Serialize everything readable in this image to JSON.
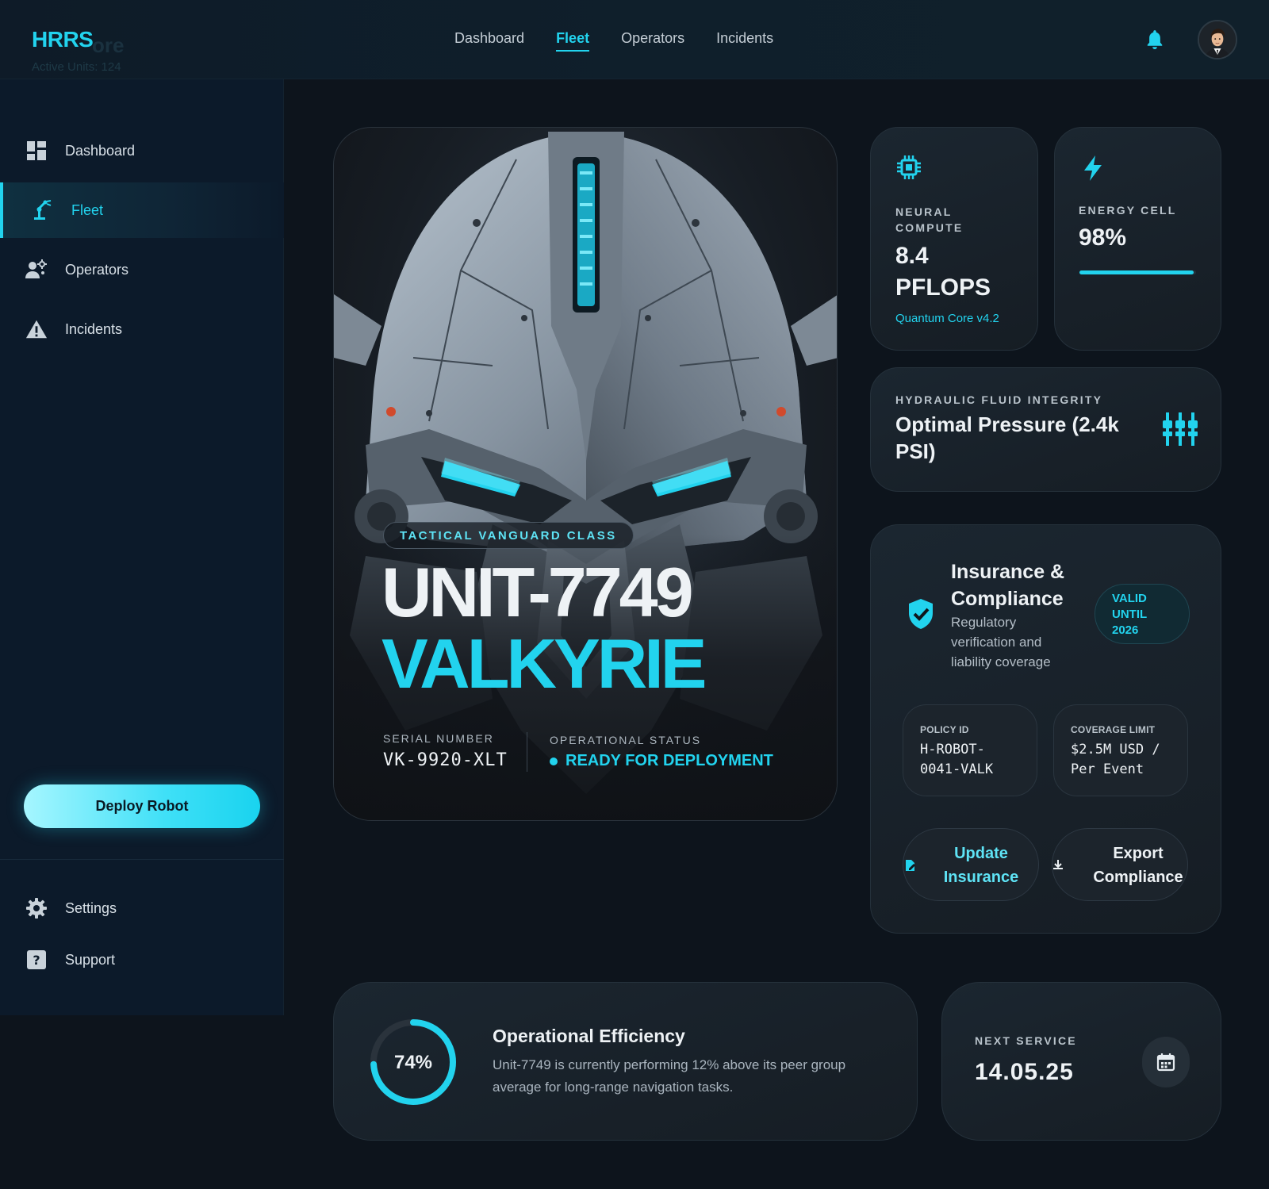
{
  "header": {
    "brand": "HRRS",
    "brand_ghost": "ore",
    "brand_sub": "Active Units: 124",
    "nav": [
      {
        "label": "Dashboard",
        "active": false
      },
      {
        "label": "Fleet",
        "active": true
      },
      {
        "label": "Operators",
        "active": false
      },
      {
        "label": "Incidents",
        "active": false
      }
    ]
  },
  "sidebar": {
    "items": [
      {
        "label": "Dashboard",
        "icon": "grid-icon",
        "active": false
      },
      {
        "label": "Fleet",
        "icon": "robot-arm-icon",
        "active": true
      },
      {
        "label": "Operators",
        "icon": "operators-icon",
        "active": false
      },
      {
        "label": "Incidents",
        "icon": "warning-icon",
        "active": false
      }
    ],
    "deploy_label": "Deploy Robot",
    "footer_items": [
      {
        "label": "Settings",
        "icon": "gear-icon"
      },
      {
        "label": "Support",
        "icon": "help-icon"
      }
    ]
  },
  "hero": {
    "class_label": "TACTICAL VANGUARD CLASS",
    "unit_name": "UNIT-7749",
    "codename": "VALKYRIE",
    "serial_label": "SERIAL NUMBER",
    "serial_value": "VK-9920-XLT",
    "status_label": "OPERATIONAL STATUS",
    "status_value": "READY FOR DEPLOYMENT"
  },
  "stats": {
    "neural": {
      "label_line1": "NEURAL",
      "label_line2": "COMPUTE",
      "value_line1": "8.4",
      "value_line2": "PFLOPS",
      "sub": "Quantum Core v4.2",
      "icon": "chip-icon"
    },
    "energy": {
      "label": "ENERGY CELL",
      "value": "98%",
      "fill": 0.98,
      "icon": "bolt-icon"
    },
    "hydraulic": {
      "label": "HYDRAULIC FLUID INTEGRITY",
      "value_line1": "Optimal Pressure (2.4k",
      "value_line2": "PSI)",
      "icon": "valves-icon"
    }
  },
  "compliance": {
    "title_line1": "Insurance &",
    "title_line2": "Compliance",
    "desc_line1": "Regulatory",
    "desc_line2": "verification and",
    "desc_line3": "liability coverage",
    "badge_line1": "VALID",
    "badge_line2": "UNTIL",
    "badge_line3": "2026",
    "policy_label": "POLICY ID",
    "policy_line1": "H-ROBOT-",
    "policy_line2": "0041-VALK",
    "coverage_label": "COVERAGE LIMIT",
    "coverage_line1": "$2.5M USD /",
    "coverage_line2": "Per Event",
    "update_line1": "Update",
    "update_line2": "Insurance",
    "export_line1": "Export",
    "export_line2": "Compliance",
    "colors": {
      "accent": "#22d3ee"
    }
  },
  "efficiency": {
    "percent_label": "74%",
    "percent": 74,
    "title": "Operational Efficiency",
    "desc_line1": "Unit-7749 is currently performing 12% above its peer group",
    "desc_line2": "average for long-range navigation tasks."
  },
  "service": {
    "label": "NEXT SERVICE",
    "date": "14.05.25",
    "icon": "calendar-icon"
  }
}
